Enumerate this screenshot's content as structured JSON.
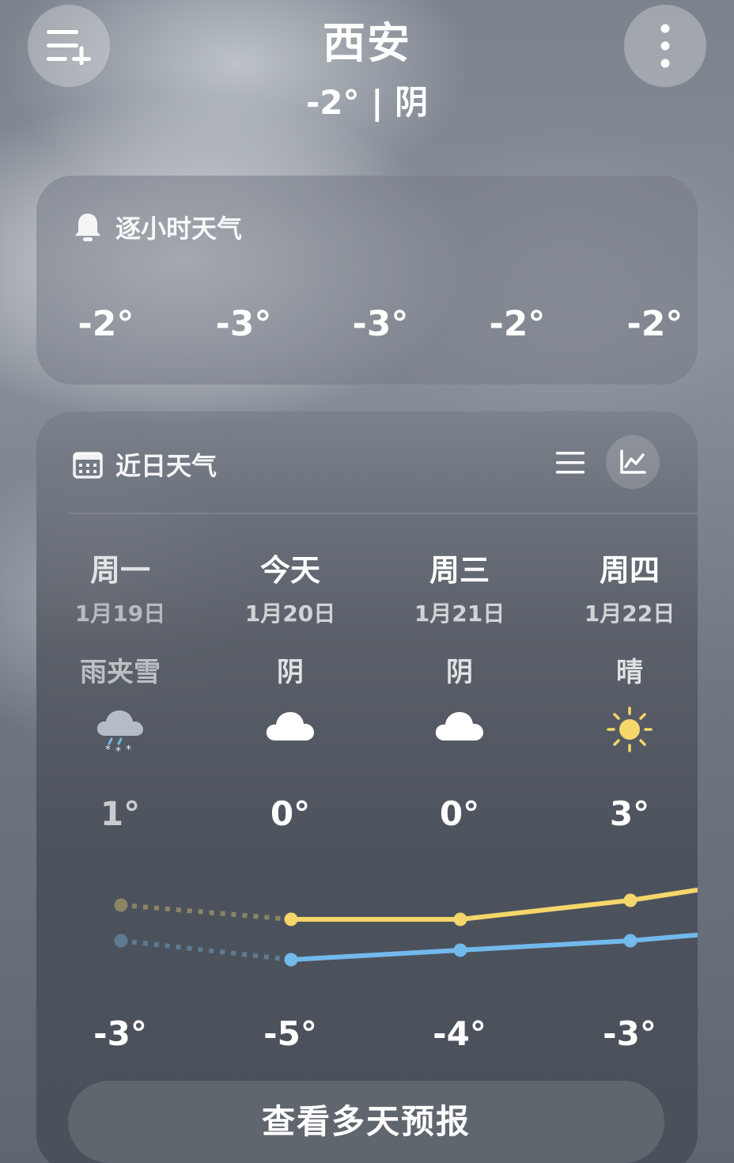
{
  "header": {
    "city": "西安",
    "summary": "-2° | 阴",
    "left_icon": "list-add-icon",
    "right_icon": "more-vertical-icon"
  },
  "hourly": {
    "title": "逐小时天气",
    "icon": "bell-icon",
    "temps": [
      "-2°",
      "-3°",
      "-3°",
      "-2°",
      "-2°"
    ]
  },
  "daily": {
    "title": "近日天气",
    "icon": "calendar-icon",
    "list_view_icon": "list-view-icon",
    "chart_view_icon": "line-chart-icon",
    "days": [
      {
        "name": "周一",
        "date": "1月19日",
        "cond": "雨夹雪",
        "icon": "sleet-icon",
        "high": "1°",
        "low": "-3°",
        "past": true
      },
      {
        "name": "今天",
        "date": "1月20日",
        "cond": "阴",
        "icon": "cloud-icon",
        "high": "0°",
        "low": "-5°",
        "past": false
      },
      {
        "name": "周三",
        "date": "1月21日",
        "cond": "阴",
        "icon": "cloud-icon",
        "high": "0°",
        "low": "-4°",
        "past": false
      },
      {
        "name": "周四",
        "date": "1月22日",
        "cond": "晴",
        "icon": "sun-icon",
        "high": "3°",
        "low": "-3°",
        "past": false
      }
    ],
    "high_values": [
      1,
      0,
      0,
      3
    ],
    "low_values": [
      -3,
      -5,
      -4,
      -3
    ],
    "colors": {
      "high": "#f5d66a",
      "low": "#72b9ec",
      "past_high": "#8b8566",
      "past_low": "#5f7a92"
    },
    "button_label": "查看多天预报"
  }
}
